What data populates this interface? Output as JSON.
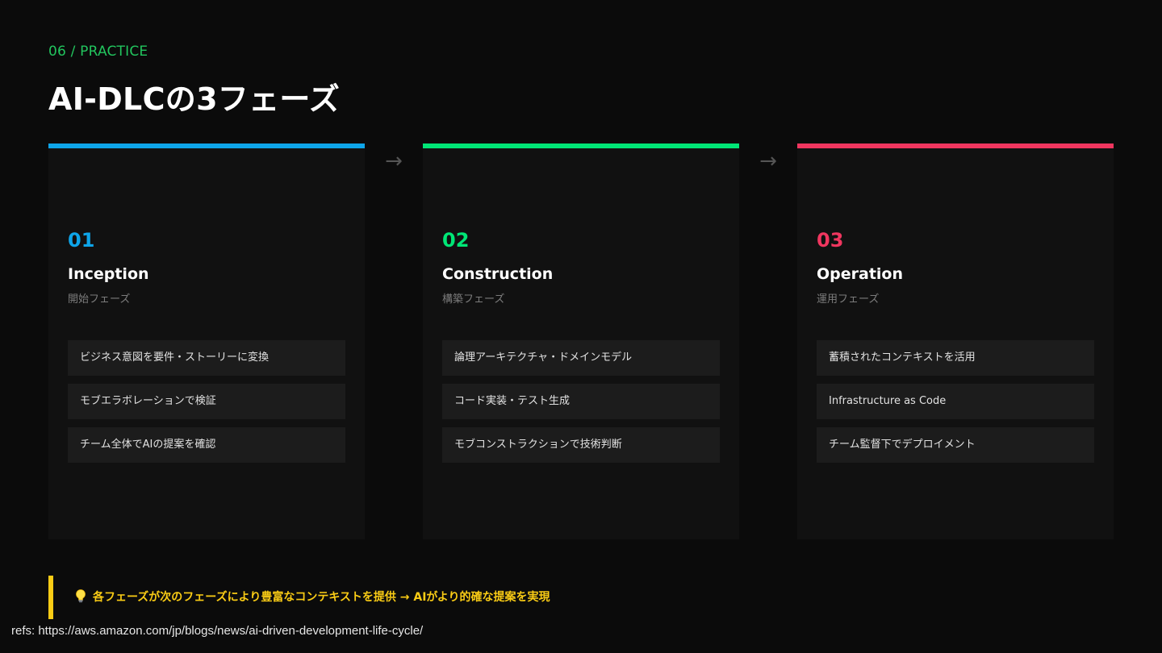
{
  "header": {
    "eyebrow": "06 / PRACTICE",
    "title": "AI-DLCの3フェーズ"
  },
  "arrow_glyph": "→",
  "phases": [
    {
      "number": "01",
      "name": "Inception",
      "subtitle": "開始フェーズ",
      "color": "#0ea5e9",
      "items": [
        "ビジネス意図を要件・ストーリーに変換",
        "モブエラボレーションで検証",
        "チーム全体でAIの提案を確認"
      ]
    },
    {
      "number": "02",
      "name": "Construction",
      "subtitle": "構築フェーズ",
      "color": "#00e676",
      "items": [
        "論理アーキテクチャ・ドメインモデル",
        "コード実装・テスト生成",
        "モブコンストラクションで技術判断"
      ]
    },
    {
      "number": "03",
      "name": "Operation",
      "subtitle": "運用フェーズ",
      "color": "#f0365f",
      "items": [
        "蓄積されたコンテキストを活用",
        "Infrastructure as Code",
        "チーム監督下でデプロイメント"
      ]
    }
  ],
  "callout": {
    "icon": "lightbulb-icon",
    "text": "各フェーズが次のフェーズにより豊富なコンテキストを提供 → AIがより的確な提案を実現",
    "color": "#facc15"
  },
  "refs": "refs: https://aws.amazon.com/jp/blogs/news/ai-driven-development-life-cycle/"
}
